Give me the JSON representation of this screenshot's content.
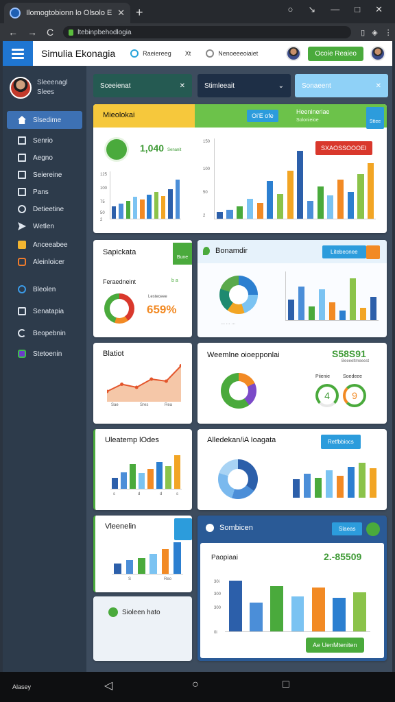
{
  "browser": {
    "tab_title": "Ilomogtobionn lo Olsolo Ekonagis",
    "new_tab": "+",
    "url": "ltebinpbehodlogia",
    "window_controls": [
      "○",
      "↘",
      "—",
      "□",
      "✕"
    ],
    "nav": [
      "←",
      "→",
      "C"
    ]
  },
  "app": {
    "title": "Simulia Ekonagia",
    "nav_item_1": "Raeiereeg",
    "nav_item_1_tail": "Xt",
    "nav_item_2": "Nenoeeeoiaiet",
    "action_button": "Ocoie Reaieo"
  },
  "profile": {
    "name": "Sleeenagl",
    "role": "Slees"
  },
  "sidebar": {
    "items": [
      {
        "label": "Slsedime",
        "icon": "home-icon"
      },
      {
        "label": "Senrio",
        "icon": "list-icon"
      },
      {
        "label": "Aegno",
        "icon": "list-icon"
      },
      {
        "label": "Seiereine",
        "icon": "list-icon"
      },
      {
        "label": "Pans",
        "icon": "list-icon"
      },
      {
        "label": "Detieetine",
        "icon": "clock-icon"
      },
      {
        "label": "Wetlen",
        "icon": "send-icon"
      },
      {
        "label": "Anceeabee",
        "icon": "folder-icon"
      },
      {
        "label": "Aleinloicer",
        "icon": "grid-icon"
      },
      {
        "label": "Bleolen",
        "icon": "settings-icon"
      },
      {
        "label": "Senatapia",
        "icon": "chat-icon"
      },
      {
        "label": "Beopebnin",
        "icon": "refresh-icon"
      },
      {
        "label": "Stetoenin",
        "icon": "app-icon"
      }
    ]
  },
  "filters": [
    {
      "label": "Sceeienat",
      "symbol": "✕"
    },
    {
      "label": "Stimleeait",
      "symbol": "⌄"
    },
    {
      "label": "Sonaeent",
      "symbol": "✕"
    }
  ],
  "card1": {
    "title": "Mieolokai",
    "chip": "Oi'E ofe",
    "right_title": "Heenineriae",
    "right_sub": "Solonieioe",
    "side_badge": "Sttee",
    "metric": "1,040",
    "metric_sub": "Senanit",
    "red_badge": "SXAOSSOOOEI",
    "y_ticks": [
      "125",
      "100",
      "75",
      "50",
      "2"
    ],
    "y_ticks_right": [
      "150",
      "100",
      "50",
      "2"
    ]
  },
  "card2": {
    "title": "Sapickata",
    "badge": "Bune",
    "label": "Feraedneint",
    "label_aside": "b a",
    "small": "Lesteceee",
    "value": "659%"
  },
  "card3": {
    "title": "Bonamdir",
    "badge": "Litebeonee"
  },
  "card4": {
    "title": "Blatiot",
    "ticks": [
      "Sae",
      "Sres",
      "Rea"
    ]
  },
  "card5": {
    "title": "Weemlne oioepponlai",
    "value": "S58S91",
    "sub": "Beeeeltmeeest",
    "legend_1": "Piienie",
    "legend_2": "Soedeee",
    "g1": "4",
    "g2": "9"
  },
  "card6": {
    "title": "Uleatemp lOdes",
    "ticks": [
      "s",
      "d",
      "d",
      "s"
    ]
  },
  "card7": {
    "title": "Alledekan/iA Ioagata",
    "badge": "Retfbbiocs"
  },
  "card8": {
    "title": "Vleenelin",
    "ticks": [
      "S",
      "Reo"
    ]
  },
  "card9": {
    "label": "Sioleen hato"
  },
  "card10": {
    "title": "Sombicen",
    "badge": "Slaeas",
    "label": "Paopiaai",
    "value": "2.-85509",
    "y_ticks": [
      "30i",
      "300",
      "300",
      "0i"
    ],
    "button": "Ae UenMteniten"
  },
  "charts": {
    "card1_left": {
      "type": "bar",
      "values": [
        18,
        22,
        26,
        32,
        28,
        36,
        40,
        34,
        44,
        58
      ]
    },
    "card1_right": {
      "type": "bar",
      "values": [
        8,
        10,
        14,
        22,
        18,
        42,
        28,
        54,
        76,
        20,
        36,
        26,
        44,
        30,
        50,
        62
      ]
    },
    "card3": {
      "type": "bar",
      "values": [
        30,
        48,
        20,
        44,
        26,
        14,
        60,
        18,
        34
      ]
    },
    "card6": {
      "type": "bar",
      "values": [
        20,
        30,
        44,
        28,
        36,
        48,
        40,
        60
      ]
    },
    "card7": {
      "type": "bar",
      "values": [
        20,
        26,
        22,
        30,
        24,
        34,
        38,
        32
      ]
    },
    "card8": {
      "type": "bar",
      "values": [
        18,
        24,
        28,
        36,
        44,
        56
      ]
    },
    "card10": {
      "type": "bar",
      "values": [
        70,
        40,
        62,
        48,
        60,
        46,
        54
      ]
    },
    "card4_area": {
      "type": "area",
      "values": [
        20,
        34,
        28,
        44,
        40,
        70
      ]
    }
  },
  "navbar": {
    "label": "Alasey",
    "back": "◁",
    "home": "○",
    "recent": "□"
  }
}
